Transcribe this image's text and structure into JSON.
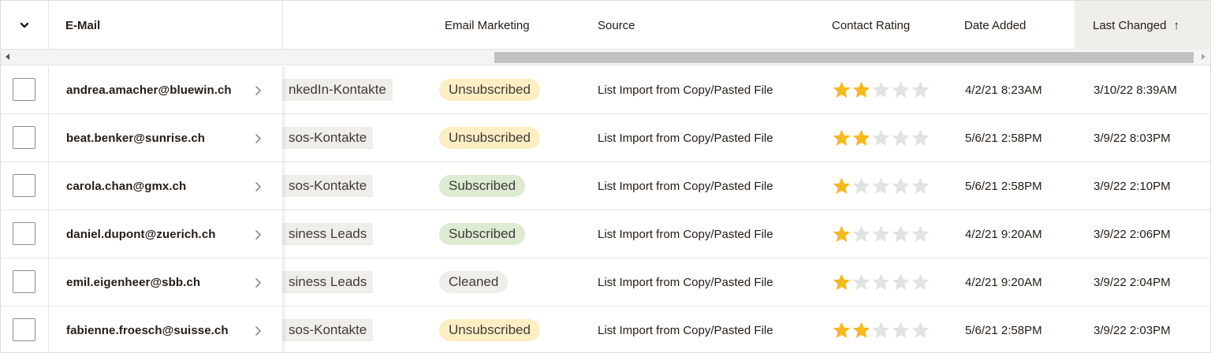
{
  "header": {
    "select_all_icon": "chevron-down-icon",
    "columns": {
      "email": "E-Mail",
      "email_marketing": "Email Marketing",
      "source": "Source",
      "contact_rating": "Contact Rating",
      "date_added": "Date Added",
      "last_changed": "Last Changed"
    },
    "sort_indicator": "↑"
  },
  "colors": {
    "unsubscribed": "#fbeec3",
    "subscribed": "#dcebd1",
    "cleaned": "#efeeea",
    "star_filled": "#f6b91e",
    "star_empty": "#e2e2e2"
  },
  "rows": [
    {
      "email": "andrea.amacher@bluewin.ch",
      "tag": "nkedIn-Kontakte",
      "status": "Unsubscribed",
      "status_kind": "unsubscribed",
      "source": "List Import from Copy/Pasted File",
      "rating": 2,
      "date_added": "4/2/21 8:23AM",
      "last_changed": "3/10/22 8:39AM"
    },
    {
      "email": "beat.benker@sunrise.ch",
      "tag": "sos-Kontakte",
      "status": "Unsubscribed",
      "status_kind": "unsubscribed",
      "source": "List Import from Copy/Pasted File",
      "rating": 2,
      "date_added": "5/6/21 2:58PM",
      "last_changed": "3/9/22 8:03PM"
    },
    {
      "email": "carola.chan@gmx.ch",
      "tag": "sos-Kontakte",
      "status": "Subscribed",
      "status_kind": "subscribed",
      "source": "List Import from Copy/Pasted File",
      "rating": 1,
      "date_added": "5/6/21 2:58PM",
      "last_changed": "3/9/22 2:10PM"
    },
    {
      "email": "daniel.dupont@zuerich.ch",
      "tag": "siness Leads",
      "status": "Subscribed",
      "status_kind": "subscribed",
      "source": "List Import from Copy/Pasted File",
      "rating": 1,
      "date_added": "4/2/21 9:20AM",
      "last_changed": "3/9/22 2:06PM"
    },
    {
      "email": "emil.eigenheer@sbb.ch",
      "tag": "siness Leads",
      "status": "Cleaned",
      "status_kind": "cleaned",
      "source": "List Import from Copy/Pasted File",
      "rating": 1,
      "date_added": "4/2/21 9:20AM",
      "last_changed": "3/9/22 2:04PM"
    },
    {
      "email": "fabienne.froesch@suisse.ch",
      "tag": "sos-Kontakte",
      "status": "Unsubscribed",
      "status_kind": "unsubscribed",
      "source": "List Import from Copy/Pasted File",
      "rating": 2,
      "date_added": "5/6/21 2:58PM",
      "last_changed": "3/9/22 2:03PM"
    }
  ]
}
